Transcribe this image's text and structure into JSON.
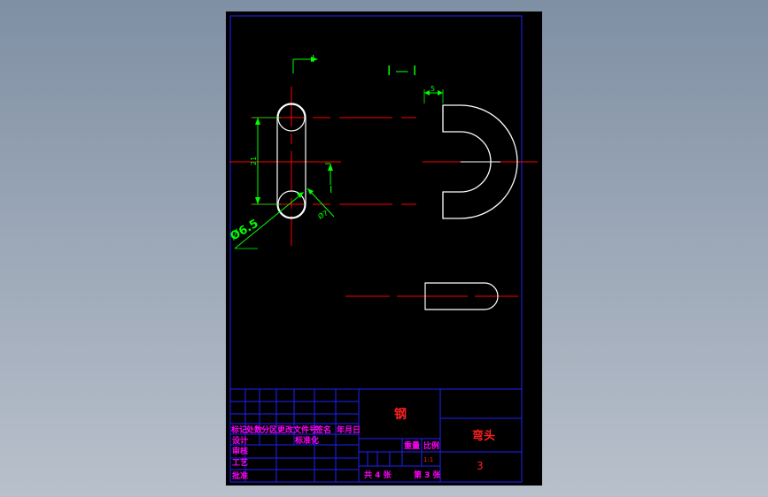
{
  "section_label": "I — I",
  "cut_marks": [
    "I",
    "I"
  ],
  "dimensions": {
    "hole_diameter": "Ø6.5",
    "hole_spacing": "21",
    "wall_thickness": "5",
    "bend_thickness": "Ø7"
  },
  "title_block": {
    "headers": [
      "标记",
      "处数",
      "分区",
      "更改文件号",
      "签名",
      "年月日"
    ],
    "rows": [
      "设计",
      "审核",
      "工艺",
      "批准"
    ],
    "standardization": "标准化",
    "material": "钢",
    "part_name": "弯头",
    "drawing_number": "3",
    "weight_label": "重量",
    "scale_label": "比例",
    "scale_value": "1:1",
    "total_sheets": "共 4 张",
    "sheet_number": "第 3 张"
  },
  "colors": {
    "background": "#000000",
    "border": "#0000ff",
    "outline": "#ffffff",
    "centerline": "#ff0000",
    "dimension": "#00ff00",
    "tb_text": "#ff00ff"
  }
}
